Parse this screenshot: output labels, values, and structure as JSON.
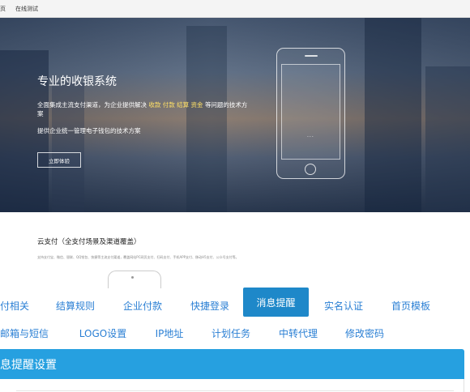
{
  "topbar": {
    "left": "页",
    "item": "在线测试"
  },
  "hero": {
    "title": "专业的收银系统",
    "line1_prefix": "全面集成主流支付渠道，为企业提供解决",
    "line1_highlight": "收款 付款 结算 资金",
    "line1_suffix": "等问题的技术方案",
    "line2": "提供企业统一管理电子钱包的技术方案",
    "button": "立即体验",
    "phone_dots": "···"
  },
  "cloud": {
    "title": "云支付（全支付场景及渠道覆盖）",
    "desc": "支持支付宝、微信、银联、QQ钱包、快捷等主流支付渠道，覆盖网站PC网页支付、扫码支付、手机APP支付、移动H5支付、公众号支付等。"
  },
  "tabs_row1": [
    "付相关",
    "结算规则",
    "企业付款",
    "快捷登录",
    "消息提醒",
    "实名认证",
    "首页模板"
  ],
  "tabs_row2": [
    "邮箱与短信",
    "LOGO设置",
    "IP地址",
    "计划任务",
    "中转代理",
    "修改密码"
  ],
  "active_tab": "消息提醒",
  "panel": {
    "title": "息提醒设置"
  },
  "colors": {
    "tab_text": "#2a7fd4",
    "tab_active_bg": "#1e88c9",
    "panel_header": "#26a0e0"
  }
}
